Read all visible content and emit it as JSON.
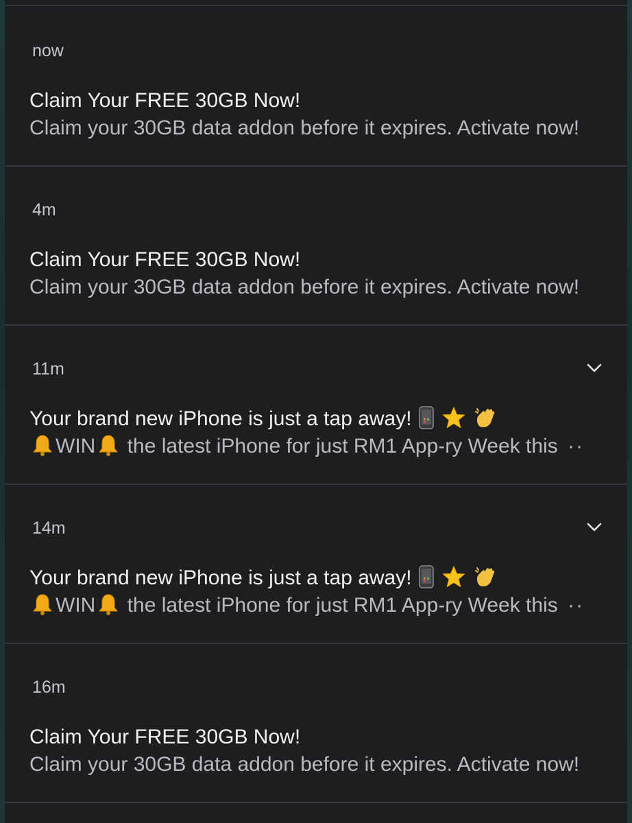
{
  "notifications": [
    {
      "time": "now",
      "title": "Claim Your FREE 30GB Now!",
      "body": "Claim your 30GB data addon before it expires. Activate now!",
      "expandable": false
    },
    {
      "time": "4m",
      "title": "Claim Your FREE 30GB Now!",
      "body": "Claim your 30GB data addon before it expires. Activate now!",
      "expandable": false
    },
    {
      "time": "11m",
      "title": "Your brand new iPhone is just a tap away!",
      "title_emojis": [
        "phone-emoji",
        "star-emoji",
        "waving-hand-emoji"
      ],
      "body_prefix": "WIN",
      "body_icon": "bell-emoji",
      "body": "the latest iPhone for just RM1 App-ry Week this",
      "truncation": "··",
      "expandable": true
    },
    {
      "time": "14m",
      "title": "Your brand new iPhone is just a tap away!",
      "title_emojis": [
        "phone-emoji",
        "star-emoji",
        "waving-hand-emoji"
      ],
      "body_prefix": "WIN",
      "body_icon": "bell-emoji",
      "body": "the latest iPhone for just RM1 App-ry Week this",
      "truncation": "··",
      "expandable": true
    },
    {
      "time": "16m",
      "title": "Claim Your FREE 30GB Now!",
      "body": "Claim your 30GB data addon before it expires. Activate now!",
      "expandable": false
    }
  ],
  "colors": {
    "panel": "#1d1e20",
    "divider": "#333538",
    "title": "#f1f1f1",
    "body": "#b8babd",
    "wallpaper": "#1f3a3a"
  }
}
